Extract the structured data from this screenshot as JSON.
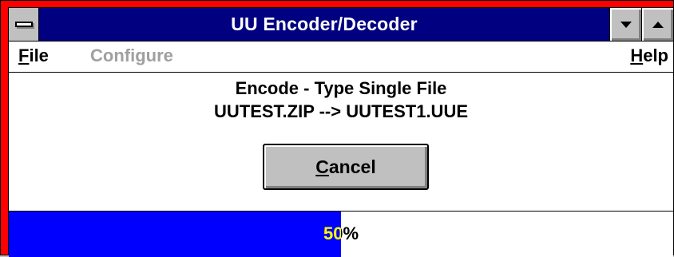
{
  "window": {
    "title": "UU Encoder/Decoder",
    "frame_color": "#ff0000",
    "titlebar_color": "#000080"
  },
  "menu": {
    "file": {
      "underlined": "F",
      "rest": "ile"
    },
    "configure": "Configure",
    "help": {
      "underlined": "H",
      "rest": "elp"
    }
  },
  "status": {
    "operation": "Encode - Type Single File",
    "files": "UUTEST.ZIP --> UUTEST1.UUE"
  },
  "buttons": {
    "cancel": {
      "underlined": "C",
      "rest": "ancel"
    }
  },
  "progress": {
    "percent": 50,
    "label": "50%",
    "fill_color": "#0000ff"
  },
  "icons": {
    "system_menu": "system-menu-icon",
    "minimize": "minimize-icon",
    "maximize": "maximize-icon"
  }
}
